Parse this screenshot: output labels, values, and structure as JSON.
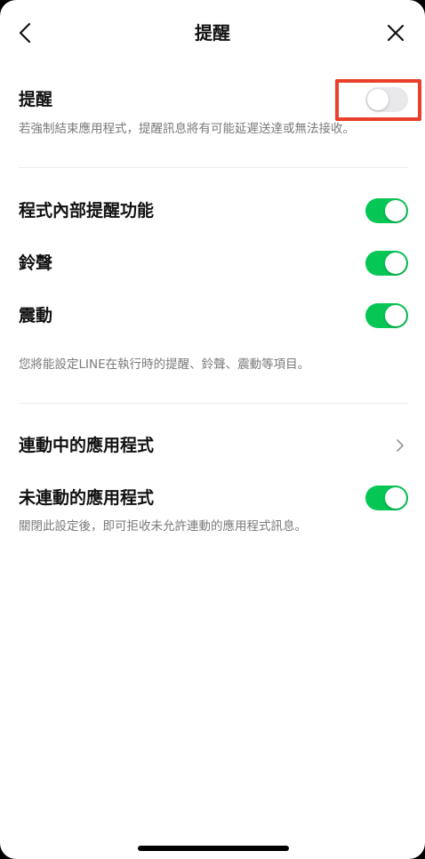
{
  "nav": {
    "title": "提醒",
    "back_icon": "chevron-left-icon",
    "close_icon": "close-icon"
  },
  "notifications": {
    "label": "提醒",
    "enabled": false,
    "description": "若強制結束應用程式，提醒訊息將有可能延遲送達或無法接收。"
  },
  "in_app": {
    "items": [
      {
        "label": "程式內部提醒功能",
        "enabled": true
      },
      {
        "label": "鈴聲",
        "enabled": true
      },
      {
        "label": "震動",
        "enabled": true
      }
    ],
    "description": "您將能設定LINE在執行時的提醒、鈴聲、震動等項目。"
  },
  "linked_apps": {
    "label": "連動中的應用程式",
    "chevron_icon": "chevron-right-icon"
  },
  "unlinked_apps": {
    "label": "未連動的應用程式",
    "enabled": true,
    "description": "關閉此設定後，即可拒收未允許連動的應用程式訊息。"
  },
  "colors": {
    "toggle_on": "#06c755",
    "toggle_off": "#e9e9eb",
    "highlight": "#e8402a"
  }
}
